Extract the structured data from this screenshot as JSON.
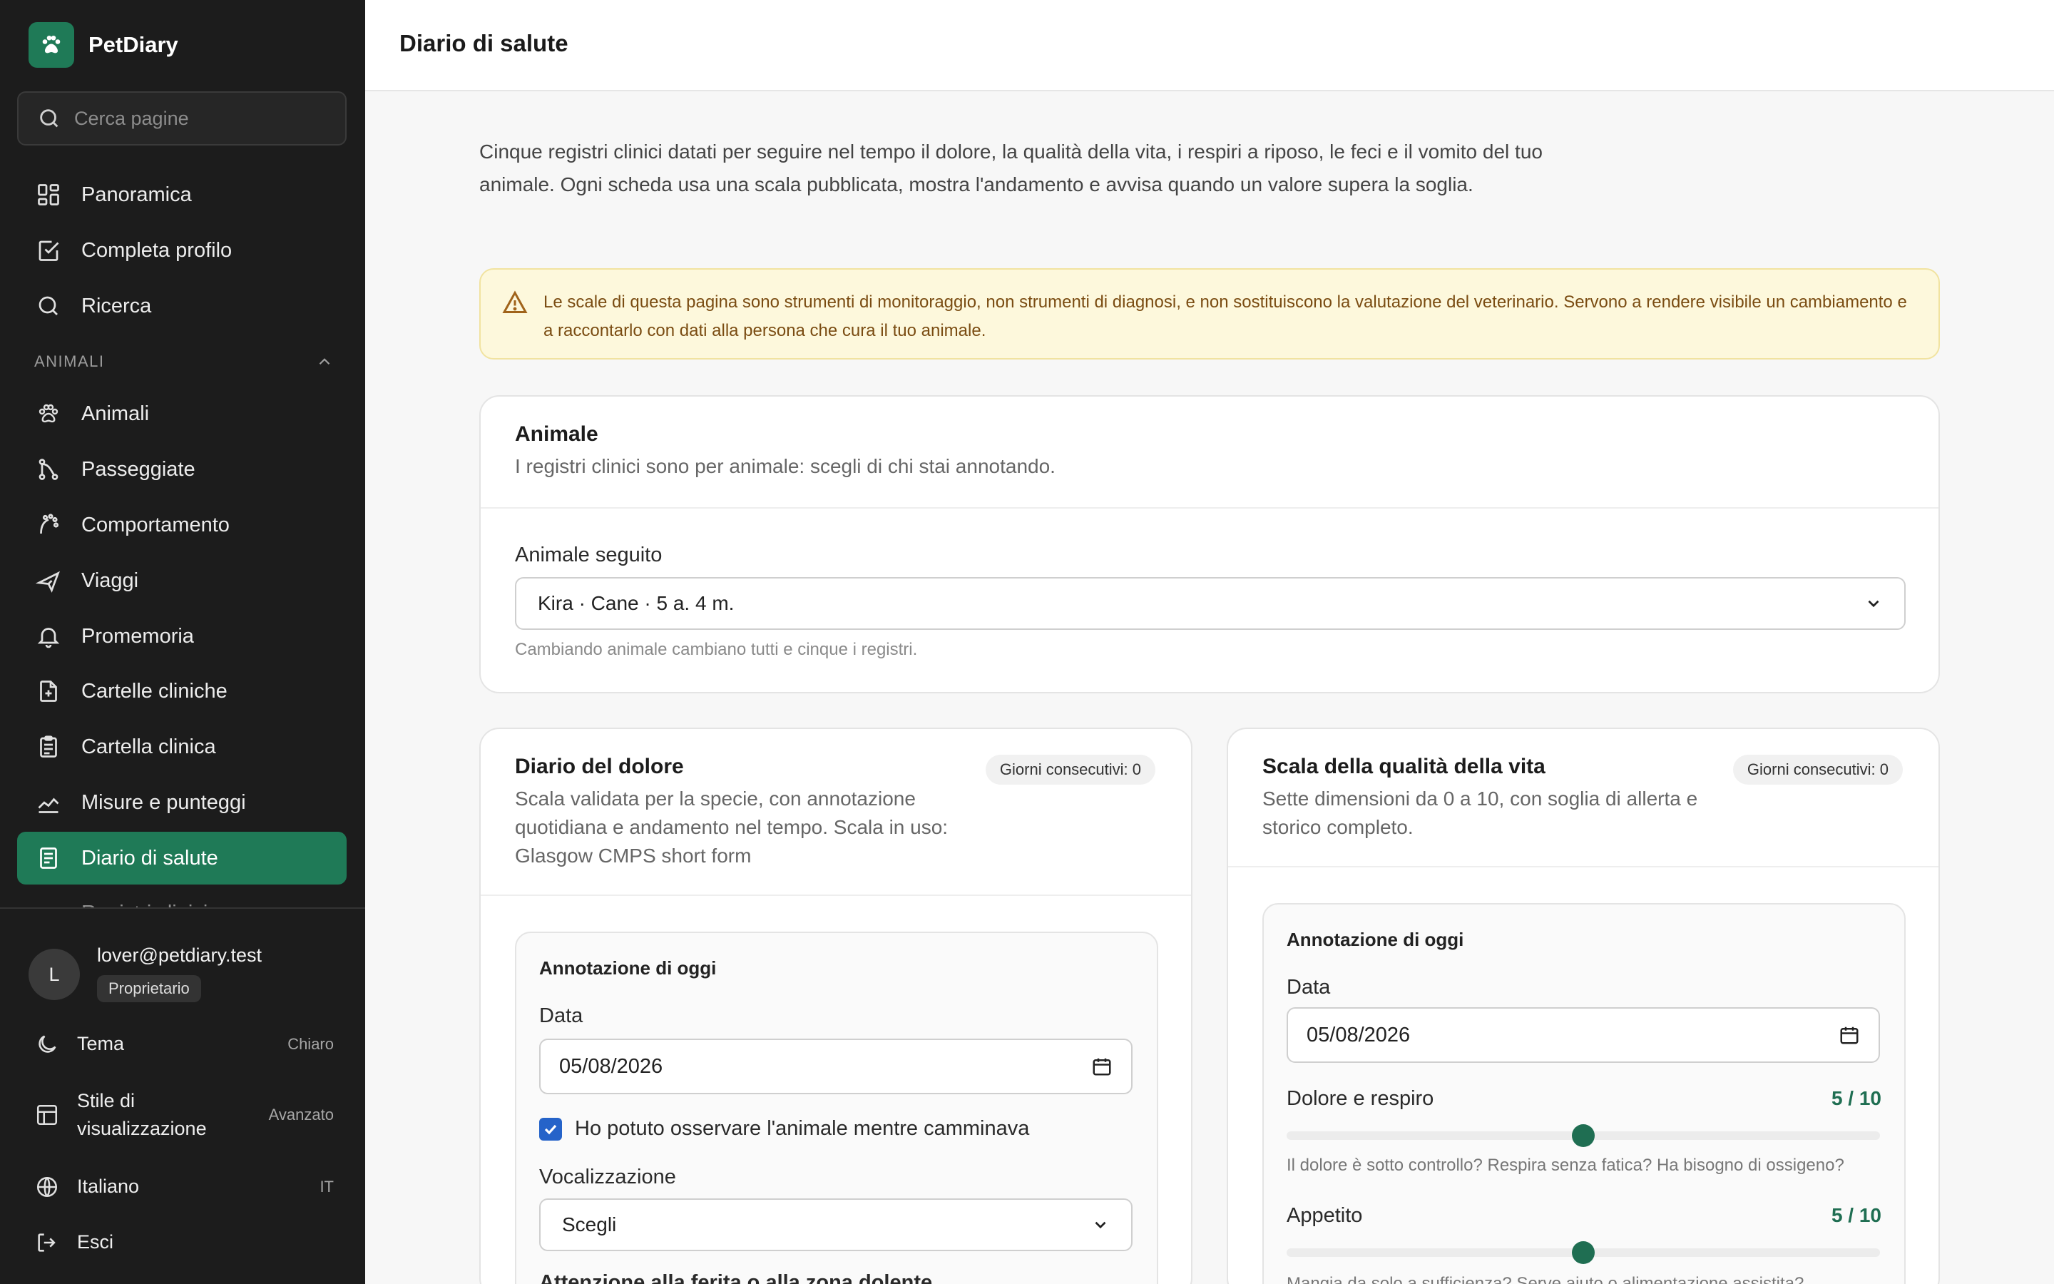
{
  "app": {
    "name": "PetDiary"
  },
  "search": {
    "placeholder": "Cerca pagine"
  },
  "nav": {
    "main": [
      {
        "label": "Panoramica",
        "icon": "grid-icon"
      },
      {
        "label": "Completa profilo",
        "icon": "check-square-icon"
      },
      {
        "label": "Ricerca",
        "icon": "search-icon"
      }
    ],
    "section_label": "ANIMALI",
    "animals": [
      {
        "label": "Animali",
        "icon": "paw-icon"
      },
      {
        "label": "Passeggiate",
        "icon": "route-icon"
      },
      {
        "label": "Comportamento",
        "icon": "behavior-icon"
      },
      {
        "label": "Viaggi",
        "icon": "plane-icon"
      },
      {
        "label": "Promemoria",
        "icon": "bell-icon"
      },
      {
        "label": "Cartelle cliniche",
        "icon": "medical-file-icon"
      },
      {
        "label": "Cartella clinica",
        "icon": "clipboard-icon"
      },
      {
        "label": "Misure e punteggi",
        "icon": "chart-line-icon"
      },
      {
        "label": "Diario di salute",
        "icon": "document-icon",
        "active": true
      },
      {
        "label": "Registri clinici",
        "icon": "list-icon"
      }
    ]
  },
  "user": {
    "initial": "L",
    "email": "lover@petdiary.test",
    "role": "Proprietario"
  },
  "footer": {
    "theme": {
      "label": "Tema",
      "value": "Chiaro"
    },
    "display": {
      "label": "Stile di visualizzazione",
      "value": "Avanzato"
    },
    "language": {
      "label": "Italiano",
      "value": "IT"
    },
    "logout": {
      "label": "Esci"
    }
  },
  "page": {
    "title": "Diario di salute",
    "intro": "Cinque registri clinici datati per seguire nel tempo il dolore, la qualità della vita, i respiri a riposo, le feci e il vomito del tuo animale. Ogni scheda usa una scala pubblicata, mostra l'andamento e avvisa quando un valore supera la soglia.",
    "alert": "Le scale di questa pagina sono strumenti di monitoraggio, non strumenti di diagnosi, e non sostituiscono la valutazione del veterinario. Servono a rendere visibile un cambiamento e a raccontarlo con dati alla persona che cura il tuo animale."
  },
  "animal_card": {
    "title": "Animale",
    "subtitle": "I registri clinici sono per animale: scegli di chi stai annotando.",
    "field_label": "Animale seguito",
    "selected": "Kira · Cane · 5 a. 4 m.",
    "hint": "Cambiando animale cambiano tutti e cinque i registri."
  },
  "pain_card": {
    "title": "Diario del dolore",
    "badge": "Giorni consecutivi: 0",
    "subtitle": "Scala validata per la specie, con annotazione quotidiana e andamento nel tempo. Scala in uso: Glasgow CMPS short form",
    "entry_title": "Annotazione di oggi",
    "date_label": "Data",
    "date_value": "05/08/2026",
    "checkbox_label": "Ho potuto osservare l'animale mentre camminava",
    "checkbox_checked": true,
    "vocal_label": "Vocalizzazione",
    "vocal_value": "Scegli",
    "next_label": "Attenzione alla ferita o alla zona dolente"
  },
  "qol_card": {
    "title": "Scala della qualità della vita",
    "badge": "Giorni consecutivi: 0",
    "subtitle": "Sette dimensioni da 0 a 10, con soglia di allerta e storico completo.",
    "entry_title": "Annotazione di oggi",
    "date_label": "Data",
    "date_value": "05/08/2026",
    "scales": [
      {
        "label": "Dolore e respiro",
        "value": 5,
        "max": 10,
        "score_text": "5 / 10",
        "hint": "Il dolore è sotto controllo? Respira senza fatica? Ha bisogno di ossigeno?"
      },
      {
        "label": "Appetito",
        "value": 5,
        "max": 10,
        "score_text": "5 / 10",
        "hint": "Mangia da solo a sufficienza? Serve aiuto o alimentazione assistita?"
      }
    ]
  },
  "colors": {
    "accent": "#1f7a57",
    "sidebar": "#1c1c1c",
    "alert_bg": "#fdf8dc",
    "alert_text": "#7a4c12"
  }
}
